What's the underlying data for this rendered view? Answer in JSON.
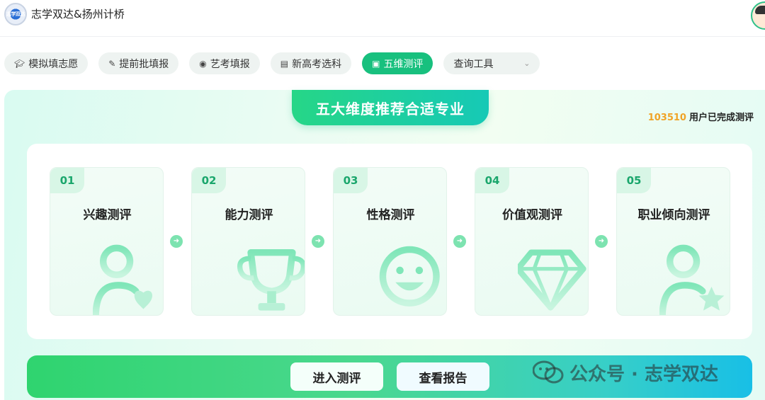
{
  "app": {
    "title": "志学双达&扬州计桥",
    "logo_text": "志学双达"
  },
  "tabs": [
    {
      "label": "模拟填志愿",
      "icon": "graduation-cap-icon"
    },
    {
      "label": "提前批填报",
      "icon": "edit-document-icon"
    },
    {
      "label": "艺考填报",
      "icon": "palette-icon"
    },
    {
      "label": "新高考选科",
      "icon": "checklist-icon"
    },
    {
      "label": "五维测评",
      "icon": "bookmark-icon",
      "active": true
    },
    {
      "label": "查询工具",
      "icon": "chevron-down-icon",
      "dropdown": true
    }
  ],
  "main": {
    "banner_title": "五大维度推荐合适专业",
    "completed_count": "103510",
    "completed_text": "用户已完成测评",
    "cards": [
      {
        "num": "01",
        "label": "兴趣测评",
        "icon": "user-heart-icon"
      },
      {
        "num": "02",
        "label": "能力测评",
        "icon": "trophy-icon"
      },
      {
        "num": "03",
        "label": "性格测评",
        "icon": "smiley-face-icon"
      },
      {
        "num": "04",
        "label": "价值观测评",
        "icon": "diamond-icon"
      },
      {
        "num": "05",
        "label": "职业倾向测评",
        "icon": "user-star-icon"
      }
    ]
  },
  "actions": {
    "enter_label": "进入测评",
    "report_label": "查看报告"
  },
  "watermark": {
    "text": "公众号 · 志学双达",
    "icon": "wechat-icon"
  },
  "colors": {
    "accent": "#18c07e",
    "count": "#f0a326",
    "icon_stroke": "#8ee8c0"
  }
}
